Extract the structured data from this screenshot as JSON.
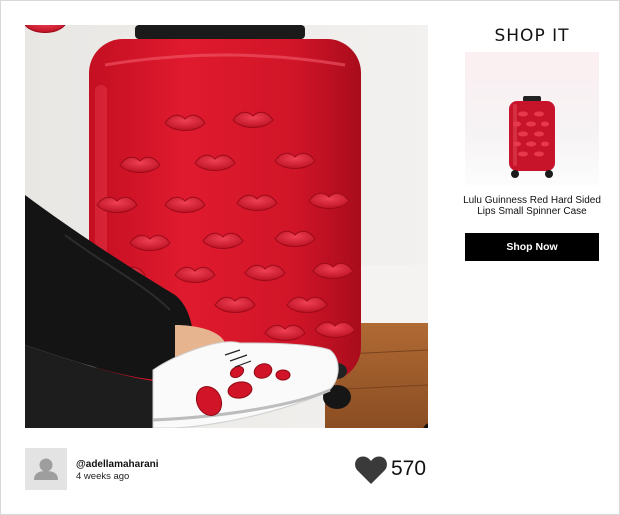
{
  "shop": {
    "title": "SHOP IT",
    "product_name": "Lulu Guinness Red Hard Sided Lips Small Spinner Case",
    "button_label": "Shop Now"
  },
  "post": {
    "username": "@adellamaharani",
    "time_ago": "4 weeks ago",
    "like_count": "570",
    "report_glyph": "!"
  },
  "icons": {
    "avatar": "user-placeholder-icon",
    "like": "heart-icon",
    "report": "exclamation-icon"
  },
  "colors": {
    "suitcase_red": "#d8152a",
    "button_bg": "#000000",
    "text": "#111111"
  }
}
